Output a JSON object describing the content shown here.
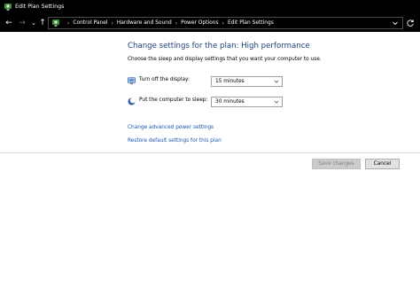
{
  "window": {
    "title": "Edit Plan Settings"
  },
  "address_bar": {
    "lead_glyph": "›",
    "separator": "›",
    "crumbs": [
      "Control Panel",
      "Hardware and Sound",
      "Power Options",
      "Edit Plan Settings"
    ]
  },
  "icons": {
    "title": "power-options-icon",
    "address": "power-options-icon",
    "display": "monitor-icon",
    "sleep": "moon-icon"
  },
  "main": {
    "heading": "Change settings for the plan: High performance",
    "subtext": "Choose the sleep and display settings that you want your computer to use.",
    "settings": [
      {
        "label": "Turn off the display:",
        "value": "15 minutes"
      },
      {
        "label": "Put the computer to sleep:",
        "value": "30 minutes"
      }
    ],
    "links": {
      "advanced": "Change advanced power settings",
      "restore": "Restore default settings for this plan"
    }
  },
  "footer": {
    "save_label": "Save changes",
    "cancel_label": "Cancel"
  },
  "colors": {
    "heading": "#1e3f7a",
    "link": "#1a55b2",
    "titlebar_bg": "#000000"
  }
}
